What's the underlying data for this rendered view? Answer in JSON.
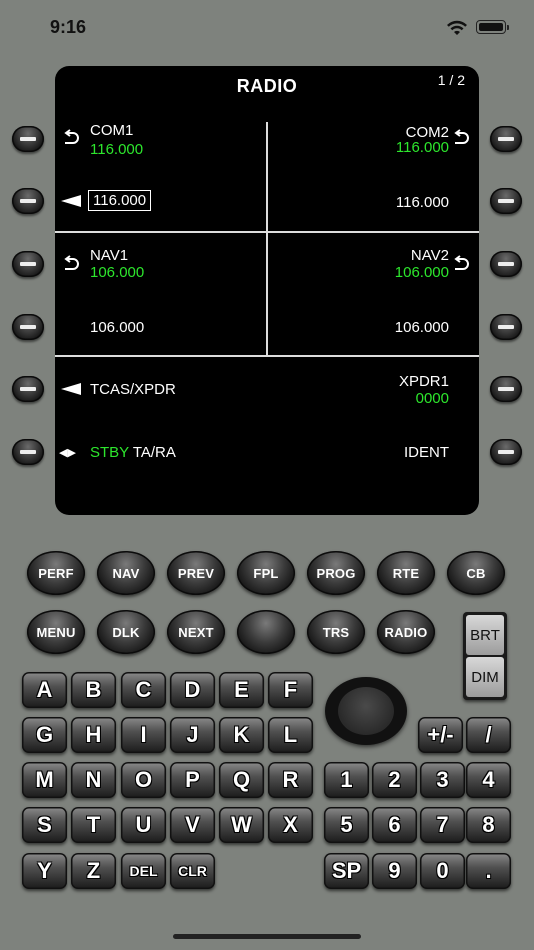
{
  "status": {
    "time": "9:16"
  },
  "screen": {
    "title": "RADIO",
    "page": "1 / 2",
    "com1": {
      "label": "COM1",
      "active": "116.000",
      "standby": "116.000"
    },
    "com2": {
      "label": "COM2",
      "active": "116.000",
      "standby": "116.000"
    },
    "nav1": {
      "label": "NAV1",
      "active": "106.000",
      "standby": "106.000"
    },
    "nav2": {
      "label": "NAV2",
      "active": "106.000",
      "standby": "106.000"
    },
    "tcas": {
      "label": "TCAS/XPDR",
      "mode_active": "STBY",
      "mode_other": "TA/RA"
    },
    "xpdr": {
      "label": "XPDR1",
      "code": "0000",
      "ident": "IDENT"
    }
  },
  "function_keys": {
    "row1": [
      "PERF",
      "NAV",
      "PREV",
      "FPL",
      "PROG",
      "RTE",
      "CB"
    ],
    "row2": [
      "MENU",
      "DLK",
      "NEXT",
      "",
      "TRS",
      "RADIO"
    ]
  },
  "brightness": {
    "brt": "BRT",
    "dim": "DIM"
  },
  "letters": [
    [
      "A",
      "B",
      "C",
      "D",
      "E",
      "F"
    ],
    [
      "G",
      "H",
      "I",
      "J",
      "K",
      "L"
    ],
    [
      "M",
      "N",
      "O",
      "P",
      "Q",
      "R"
    ],
    [
      "S",
      "T",
      "U",
      "V",
      "W",
      "X"
    ],
    [
      "Y",
      "Z",
      "DEL",
      "CLR"
    ]
  ],
  "numpad": [
    [
      "+/-",
      "/"
    ],
    [
      "1",
      "2",
      "3",
      "4"
    ],
    [
      "5",
      "6",
      "7",
      "8"
    ],
    [
      "SP",
      "9",
      "0",
      "."
    ]
  ],
  "colors": {
    "active_frequency": "#2de62d",
    "background": "#7e827d",
    "screen": "#000000"
  }
}
